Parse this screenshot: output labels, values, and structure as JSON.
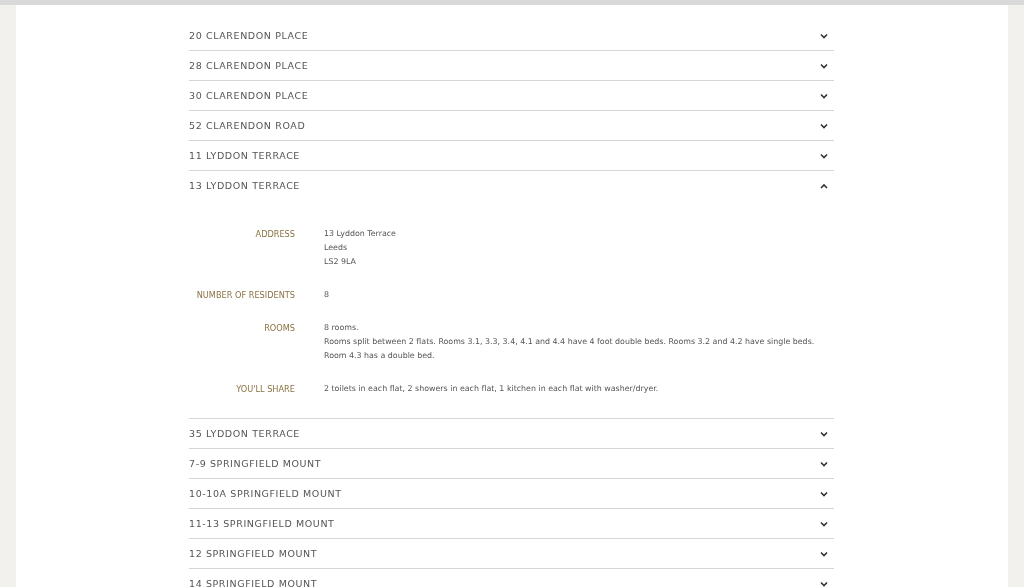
{
  "accordion": [
    {
      "title": "20 CLARENDON PLACE",
      "expanded": false
    },
    {
      "title": "28 CLARENDON PLACE",
      "expanded": false
    },
    {
      "title": "30 CLARENDON PLACE",
      "expanded": false
    },
    {
      "title": "52 CLARENDON ROAD",
      "expanded": false
    },
    {
      "title": "11 LYDDON TERRACE",
      "expanded": false
    },
    {
      "title": "13 LYDDON TERRACE",
      "expanded": true,
      "details": [
        {
          "label": "ADDRESS",
          "lines": [
            "13 Lyddon Terrace",
            "Leeds",
            "LS2 9LA"
          ]
        },
        {
          "label": "NUMBER OF RESIDENTS",
          "lines": [
            "8"
          ]
        },
        {
          "label": "ROOMS",
          "lines": [
            "8 rooms.",
            "Rooms split between 2 flats. Rooms 3.1, 3.3, 3.4, 4.1 and 4.4 have 4 foot double beds. Rooms 3.2 and 4.2 have single beds. Room 4.3 has a double bed."
          ]
        },
        {
          "label": "YOU'LL SHARE",
          "lines": [
            "2 toilets in each flat, 2 showers in each flat, 1 kitchen in each flat with washer/dryer."
          ]
        }
      ]
    },
    {
      "title": "35 LYDDON TERRACE",
      "expanded": false
    },
    {
      "title": "7-9 SPRINGFIELD MOUNT",
      "expanded": false
    },
    {
      "title": "10-10A SPRINGFIELD MOUNT",
      "expanded": false
    },
    {
      "title": "11-13 SPRINGFIELD MOUNT",
      "expanded": false
    },
    {
      "title": "12 SPRINGFIELD MOUNT",
      "expanded": false
    },
    {
      "title": "14 SPRINGFIELD MOUNT",
      "expanded": false
    }
  ]
}
